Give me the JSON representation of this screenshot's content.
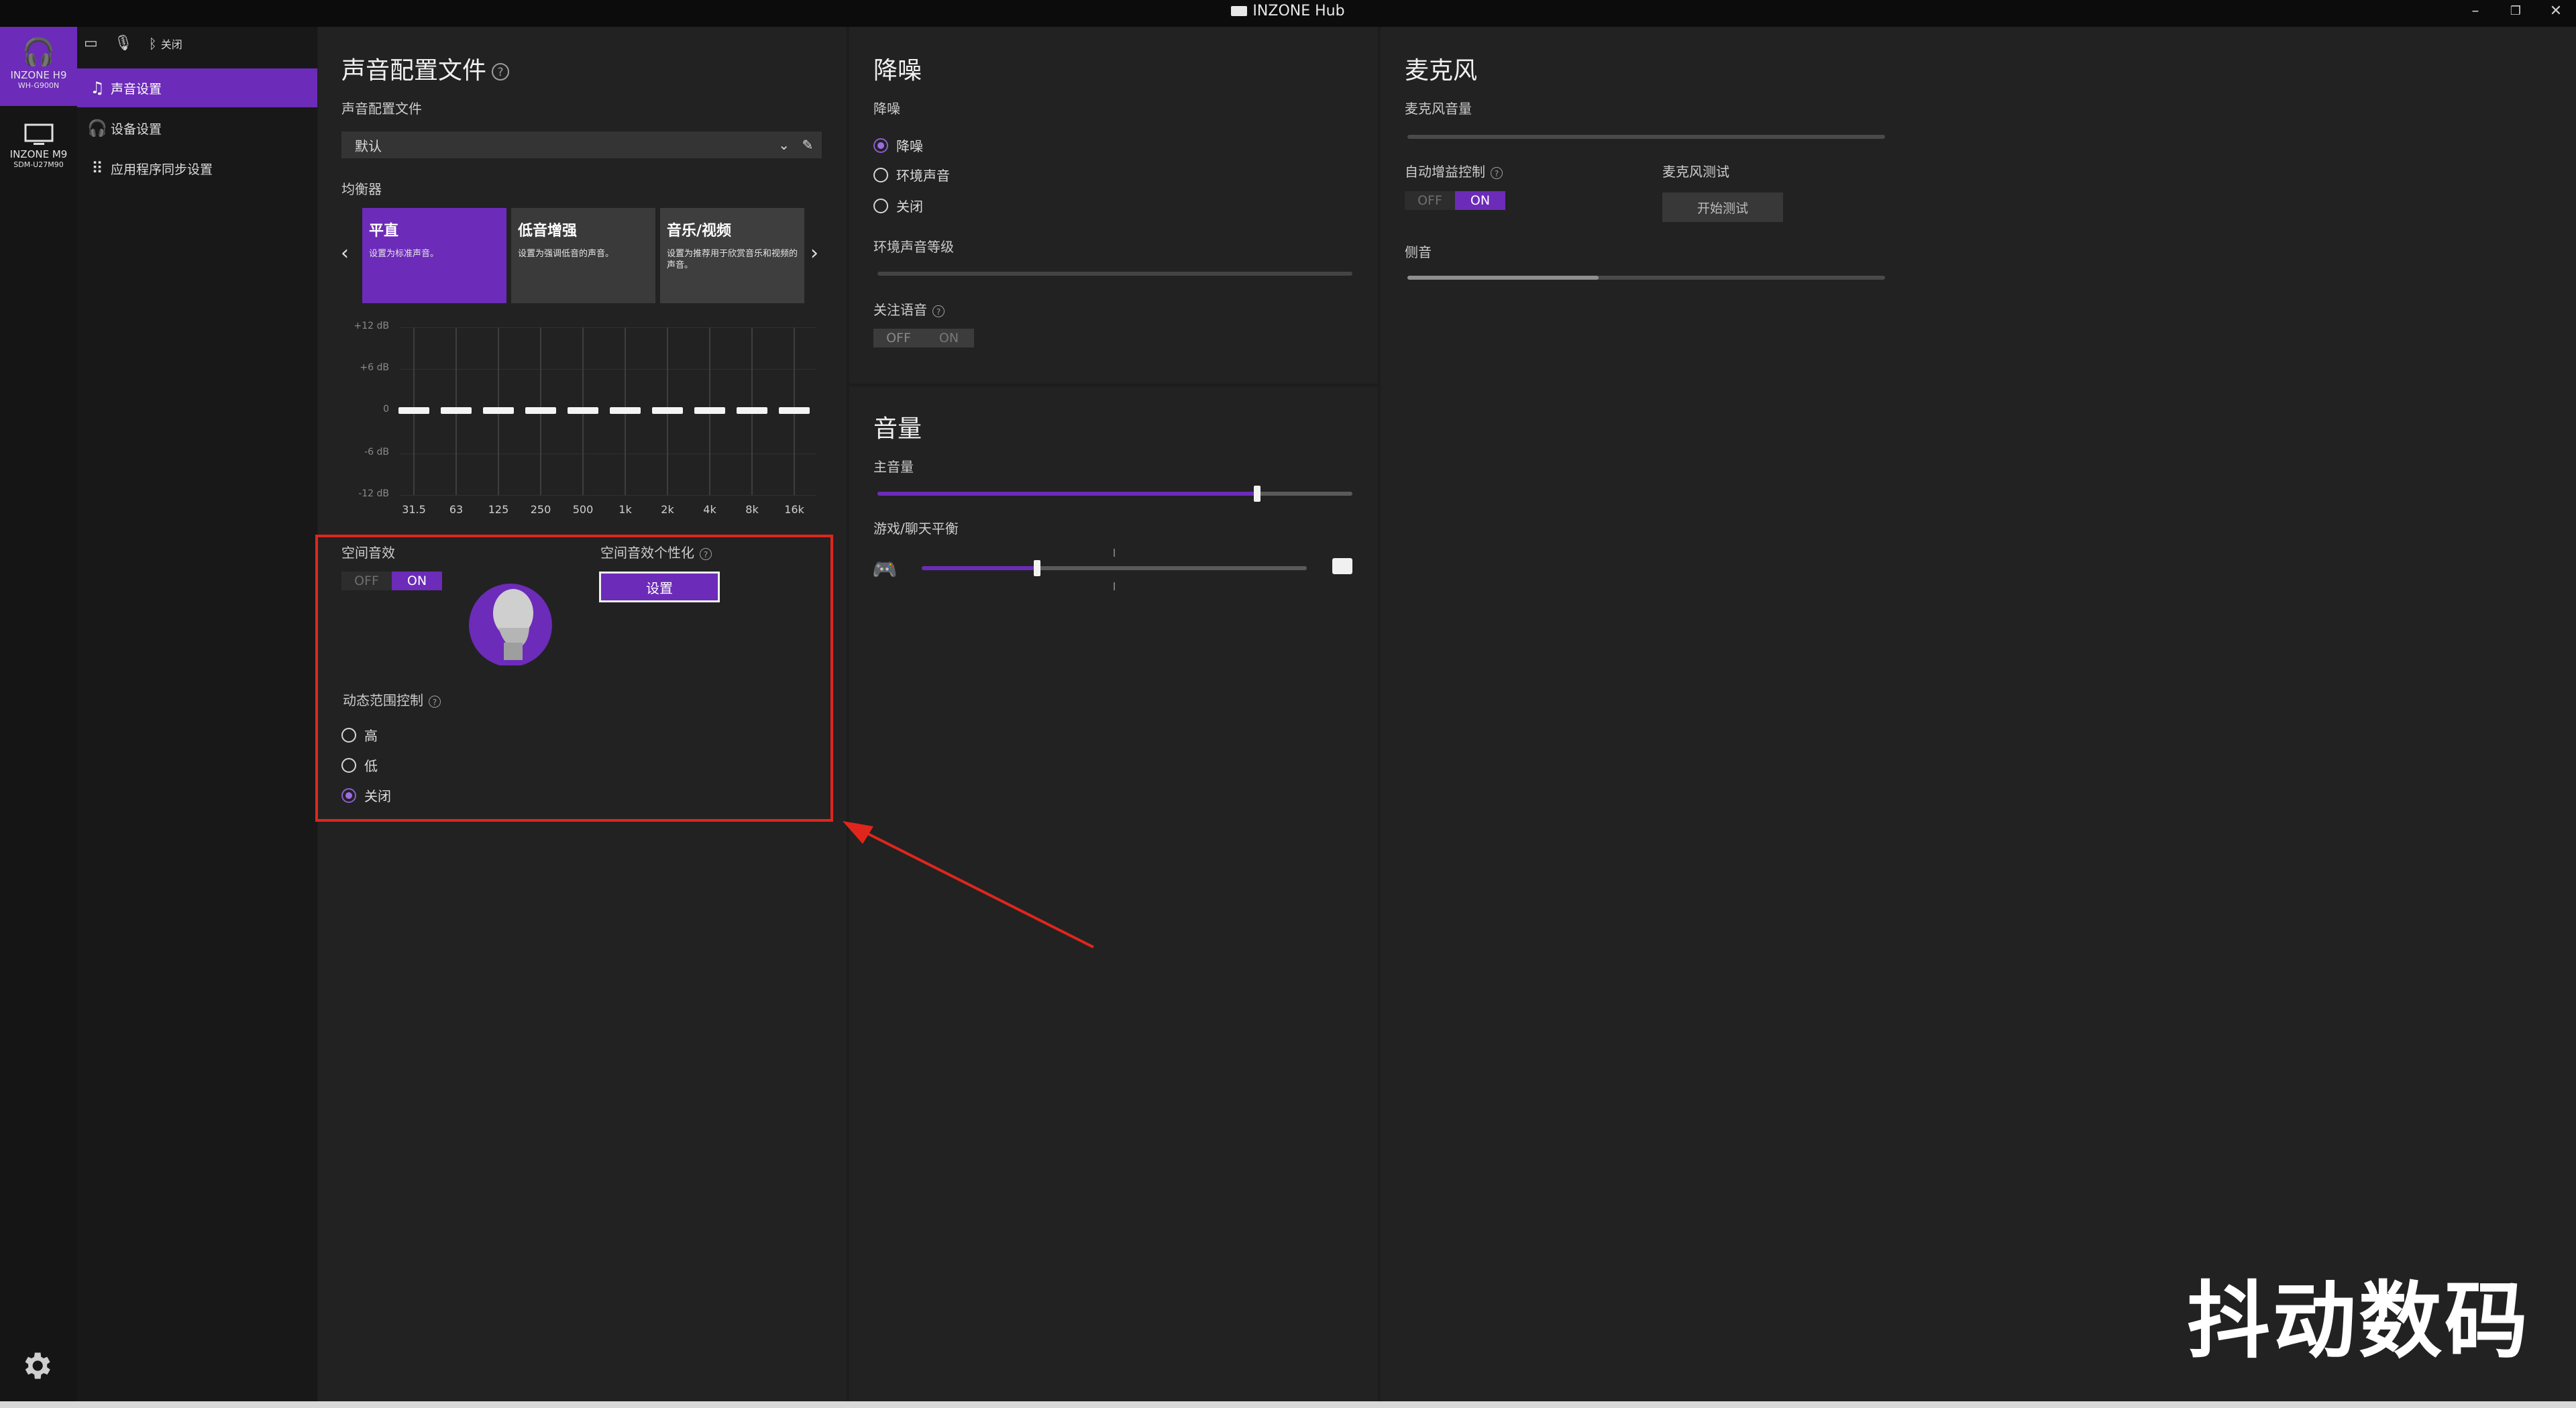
{
  "window": {
    "title": "INZONE Hub",
    "controls": [
      "–",
      "❐",
      "✕"
    ]
  },
  "status_bar": {
    "battery_icon": "battery-icon",
    "mic_mute_icon": "mic-muted-icon",
    "bluetooth_icon": "bluetooth-icon",
    "bluetooth_label": "关闭"
  },
  "devices": [
    {
      "name": "INZONE H9",
      "model": "WH-G900N",
      "active": true
    },
    {
      "name": "INZONE M9",
      "model": "SDM-U27M90",
      "active": false
    }
  ],
  "nav": [
    {
      "label": "声音设置",
      "icon": "music-note-icon",
      "active": true
    },
    {
      "label": "设备设置",
      "icon": "headphones-icon",
      "active": false
    },
    {
      "label": "应用程序同步设置",
      "icon": "grid-icon",
      "active": false
    }
  ],
  "sound_profile": {
    "title": "声音配置文件",
    "profile_label": "声音配置文件",
    "profile_value": "默认",
    "eq_label": "均衡器",
    "presets": [
      {
        "title": "平直",
        "desc": "设置为标准声音。",
        "active": true
      },
      {
        "title": "低音增强",
        "desc": "设置为强调低音的声音。",
        "active": false
      },
      {
        "title": "音乐/视频",
        "desc": "设置为推荐用于欣赏音乐和视频的声音。",
        "active": false
      }
    ],
    "db_labels": [
      "+12 dB",
      "+6 dB",
      "0",
      "-6 dB",
      "-12 dB"
    ],
    "eq_bands": [
      {
        "freq": "31.5",
        "gain_db": 0
      },
      {
        "freq": "63",
        "gain_db": 0
      },
      {
        "freq": "125",
        "gain_db": 0
      },
      {
        "freq": "250",
        "gain_db": 0
      },
      {
        "freq": "500",
        "gain_db": 0
      },
      {
        "freq": "1k",
        "gain_db": 0
      },
      {
        "freq": "2k",
        "gain_db": 0
      },
      {
        "freq": "4k",
        "gain_db": 0
      },
      {
        "freq": "8k",
        "gain_db": 0
      },
      {
        "freq": "16k",
        "gain_db": 0
      }
    ],
    "spatial_label": "空间音效",
    "spatial_on": true,
    "personalize_label": "空间音效个性化",
    "personalize_button": "设置",
    "drc_label": "动态范围控制",
    "drc_options": [
      {
        "label": "高",
        "checked": false
      },
      {
        "label": "低",
        "checked": false
      },
      {
        "label": "关闭",
        "checked": true
      }
    ]
  },
  "toggle_text": {
    "off": "OFF",
    "on": "ON"
  },
  "noise": {
    "title": "降噪",
    "label": "降噪",
    "options": [
      {
        "label": "降噪",
        "checked": true
      },
      {
        "label": "环境声音",
        "checked": false
      },
      {
        "label": "关闭",
        "checked": false
      }
    ],
    "ambient_level_label": "环境声音等级",
    "focus_voice_label": "关注语音",
    "focus_voice_on": false
  },
  "volume": {
    "title": "音量",
    "master_label": "主音量",
    "master_level": 0.8,
    "balance_label": "游戏/聊天平衡",
    "balance_level": 0.3,
    "game_icon": "gamepad-icon",
    "chat_icon": "chat-bubble-icon"
  },
  "mic": {
    "title": "麦克风",
    "volume_label": "麦克风音量",
    "agc_label": "自动增益控制",
    "agc_on": true,
    "test_label": "麦克风测试",
    "test_button": "开始测试",
    "sidetone_label": "侧音",
    "sidetone_level": 0.4
  },
  "watermark": "抖动数码",
  "colors": {
    "accent": "#6c2bb8",
    "highlight_box": "#e0261c",
    "arrow": "#e0261c"
  }
}
